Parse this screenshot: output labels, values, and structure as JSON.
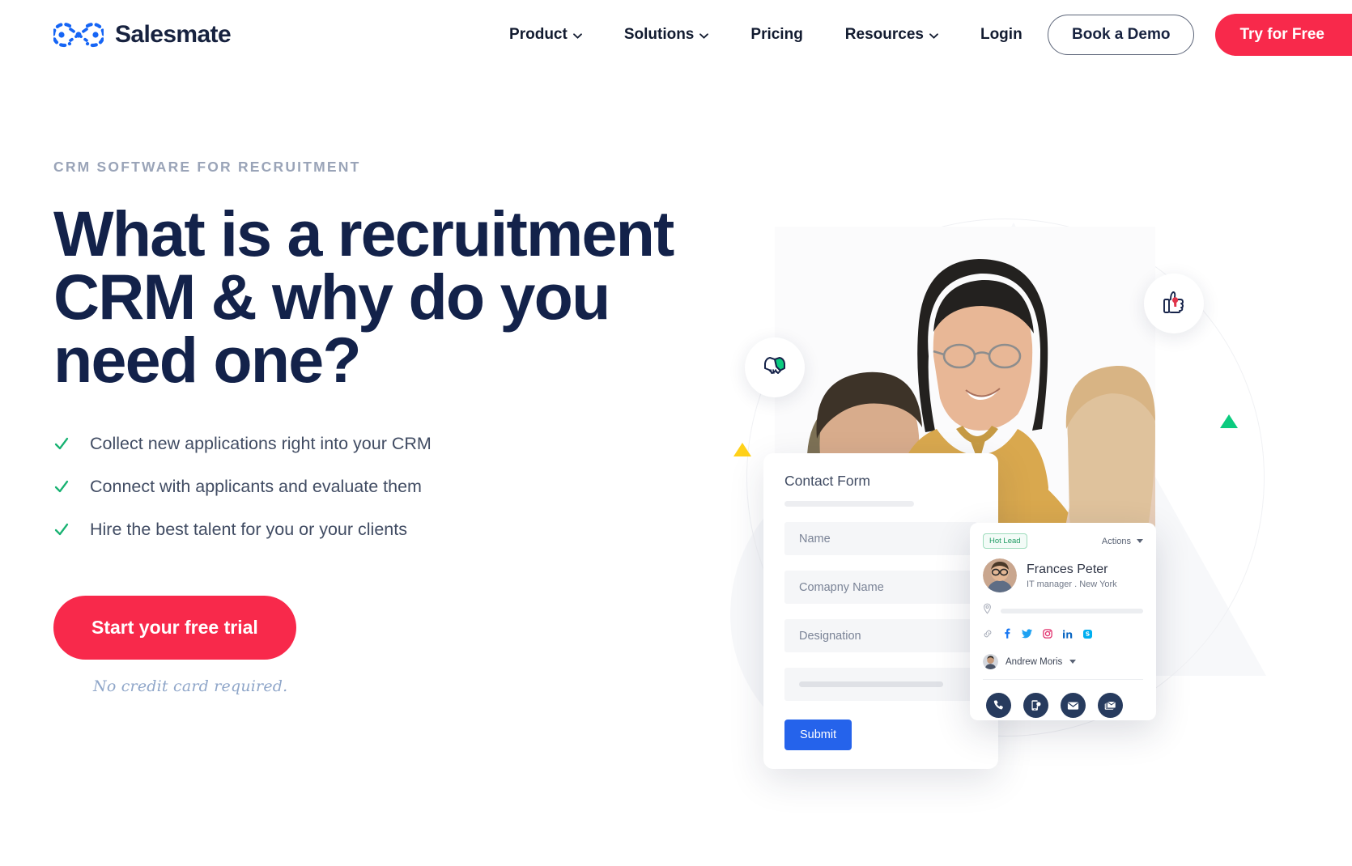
{
  "brand": {
    "name": "Salesmate",
    "logo_icon": "salesmate-logo-icon",
    "accent": "#f8294b",
    "navy": "#13224a"
  },
  "nav": {
    "items": [
      {
        "label": "Product",
        "has_dropdown": true,
        "icon": "chevron-down-icon"
      },
      {
        "label": "Solutions",
        "has_dropdown": true,
        "icon": "chevron-down-icon"
      },
      {
        "label": "Pricing",
        "has_dropdown": false,
        "icon": ""
      },
      {
        "label": "Resources",
        "has_dropdown": true,
        "icon": "chevron-down-icon"
      },
      {
        "label": "Login",
        "has_dropdown": false,
        "icon": ""
      }
    ],
    "demo_button": "Book a Demo",
    "try_button": "Try for Free"
  },
  "hero": {
    "eyebrow": "CRM SOFTWARE FOR RECRUITMENT",
    "headline": "What is a recruitment CRM & why do you need one?",
    "bullets": [
      "Collect new applications right into your CRM",
      "Connect with applicants and evaluate them",
      "Hire the best talent for you or your clients"
    ],
    "cta_label": "Start your free trial",
    "note": "No credit card required.",
    "check_icon": "green-check-icon",
    "check_color": "#18b272"
  },
  "visual": {
    "photo_alt": "three-people-handshake-photo",
    "badges": [
      {
        "icon": "handshake-icon",
        "color": "#0bcb7f"
      },
      {
        "icon": "thumbs-up-icon",
        "color": "#e0344a"
      }
    ],
    "shapes": [
      {
        "icon": "yellow-triangle-icon",
        "color": "#ffd119"
      },
      {
        "icon": "green-triangle-icon",
        "color": "#0bcb7f"
      }
    ]
  },
  "contact_form": {
    "title": "Contact Form",
    "fields": [
      {
        "placeholder": "Name"
      },
      {
        "placeholder": "Comapny Name"
      },
      {
        "placeholder": "Designation"
      }
    ],
    "submit_label": "Submit",
    "submit_color": "#2563eb"
  },
  "lead_card": {
    "badge": "Hot Lead",
    "badge_color": "#1f9b63",
    "actions_label": "Actions",
    "avatar_icon": "contact-avatar",
    "name": "Frances Peter",
    "meta": "IT manager . New York",
    "location_icon": "map-pin-icon",
    "link_icon": "link-icon",
    "social": [
      {
        "name": "facebook-icon",
        "color": "#1877f2"
      },
      {
        "name": "twitter-icon",
        "color": "#1da1f2"
      },
      {
        "name": "instagram-icon",
        "color": "#e1306c"
      },
      {
        "name": "linkedin-icon",
        "color": "#0a66c2"
      },
      {
        "name": "skype-icon",
        "color": "#00aff0"
      }
    ],
    "owner": "Andrew Moris",
    "owner_dropdown_icon": "caret-down-icon",
    "actions": [
      {
        "name": "call-icon"
      },
      {
        "name": "sms-icon"
      },
      {
        "name": "email-icon"
      },
      {
        "name": "bulk-email-icon"
      }
    ]
  }
}
